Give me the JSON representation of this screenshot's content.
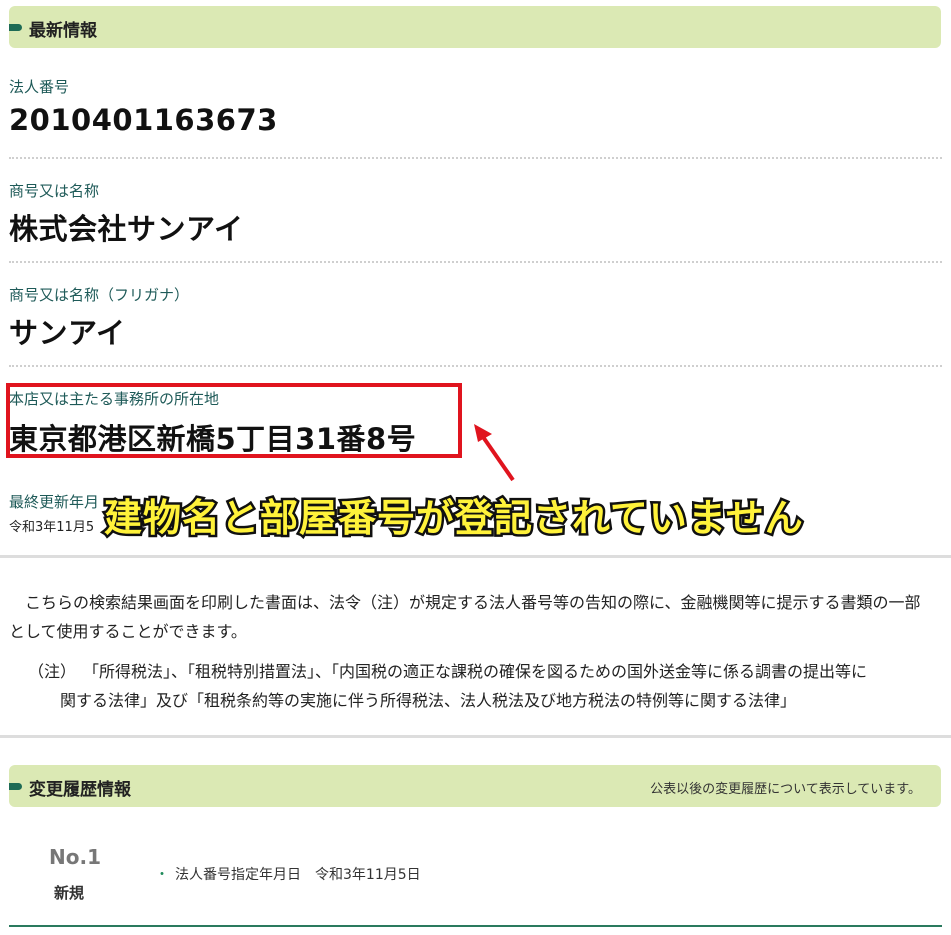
{
  "latest": {
    "section_title": "最新情報",
    "fields": [
      {
        "label": "法人番号",
        "value": "2010401163673"
      },
      {
        "label": "商号又は名称",
        "value": "株式会社サンアイ"
      },
      {
        "label": "商号又は名称（フリガナ）",
        "value": "サンアイ"
      },
      {
        "label": "本店又は主たる事務所の所在地",
        "value": "東京都港区新橋5丁目31番8号"
      },
      {
        "label": "最終更新年月",
        "value": "令和3年11月5"
      }
    ]
  },
  "annotation": {
    "text": "建物名と部屋番号が登記されていません",
    "color": "#fff23a",
    "box_color": "#e0141e"
  },
  "notice": {
    "paragraph": "　こちらの検索結果画面を印刷した書面は、法令（注）が規定する法人番号等の告知の際に、金融機関等に提示する書類の一部として使用することができます。",
    "note_mark": "（注）",
    "note_line1": "「所得税法」、「租税特別措置法」、「内国税の適正な課税の確保を図るための国外送金等に係る調書の提出等に",
    "note_line2": "関する法律」及び「租税条約等の実施に伴う所得税法、法人税法及び地方税法の特例等に関する法律」"
  },
  "history": {
    "section_title": "変更履歴情報",
    "note": "公表以後の変更履歴について表示しています。",
    "entries": [
      {
        "no": "No.1",
        "kind": "新規",
        "item": "法人番号指定年月日　令和3年11月5日"
      }
    ]
  },
  "colors": {
    "header_bg": "#dbe9b4",
    "accent": "#1e6b55",
    "label": "#1e5a58"
  }
}
